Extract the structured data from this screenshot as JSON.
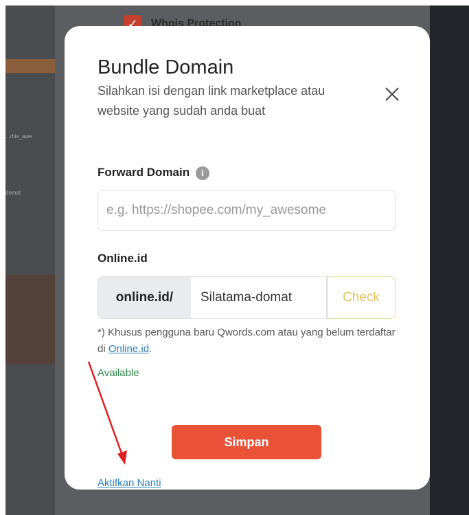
{
  "background": {
    "whois_label": "Whois Protection",
    "fragment_1": "...rhis_awe",
    "fragment_2": "domat"
  },
  "modal": {
    "title": "Bundle Domain",
    "subtitle": "Silahkan isi dengan link marketplace atau website yang sudah anda buat",
    "forward_label": "Forward Domain",
    "forward_placeholder": "e.g. https://shopee.com/my_awesome",
    "online_label": "Online.id",
    "online_prefix": "online.id/",
    "online_value": "Silatama-domat",
    "check_label": "Check",
    "note_text": "*) Khusus pengguna baru Qwords.com atau yang belum terdaftar di ",
    "note_link": "Online.id",
    "note_end": ".",
    "status": "Available",
    "save_label": "Simpan",
    "later_label": "Aktifkan Nanti"
  },
  "colors": {
    "accent": "#e95237",
    "check": "#e6c35a",
    "available": "#2f8a4d",
    "link": "#2c7fb8",
    "annotation_arrow": "#e02020"
  },
  "icons": {
    "close": "close-icon",
    "info": "info-icon",
    "checkbox": "checkbox-checked-icon"
  }
}
